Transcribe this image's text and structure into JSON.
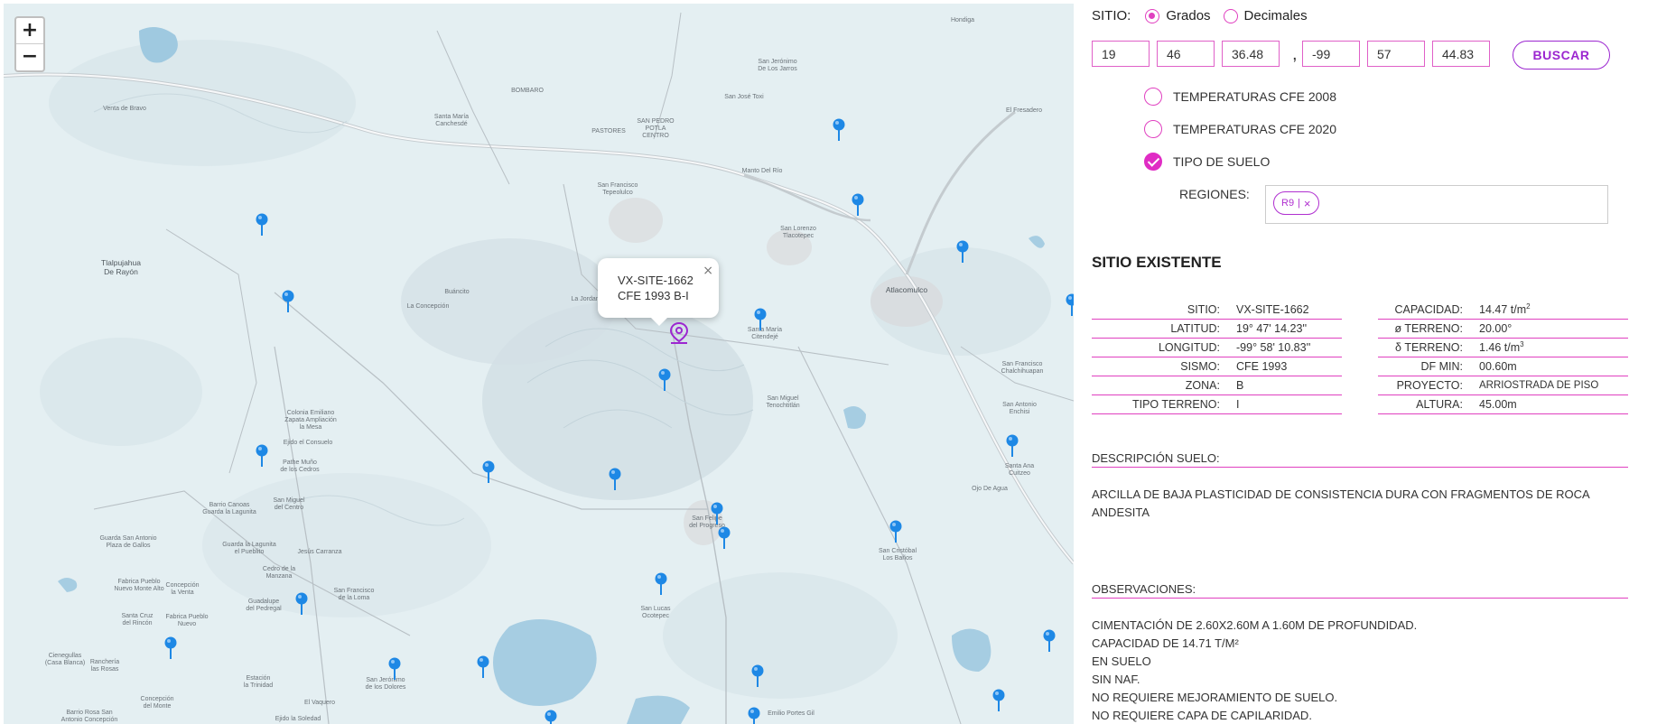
{
  "map": {
    "zoom_in": "+",
    "zoom_out": "−",
    "popup": {
      "line1": "VX-SITE-1662",
      "line2": "CFE 1993 B-I",
      "close": "×"
    },
    "labels": {
      "l1": "Tlalpujahua\nDe Rayón",
      "l2": "Atlacomulco",
      "l3": "Santa María\nCanchesdé",
      "l4": "SAN PEDRO\nPOTLA\nCENTRO",
      "l5": "PASTORES",
      "l6": "San Francisco\nTepeolulco",
      "l7": "Manto Del Río",
      "l8": "San Lorenzo\nTlacotepec",
      "l9": "San Jerónimo\nDe Los Jarros",
      "l10": "San José Toxi",
      "l11": "Hondiga",
      "l12": "El Fresadero",
      "l13": "Santa María\nCitendejé",
      "l14": "San Miguel\nTenochtitlán",
      "l15": "Colonia Emiliano\nZapata Ampliación\nla Mesa",
      "l16": "Ejido el Consuelo",
      "l17": "Pathe Muño\nde los Cedros",
      "l18": "San Miguel\ndel Centro",
      "l19": "Guarda la Lagunita\nel Pueblito",
      "l20": "Barrio Canoas\nGuarda la Lagunita",
      "l21": "Guarda San Antonio\nPlaza de Gallos",
      "l22": "San Francisco\nde la Loma",
      "l23": "Jesús Carranza",
      "l24": "Cedro de la\nManzana",
      "l25": "Guadalupe\ndel Pedregal",
      "l26": "San Lucas\nOcotepec",
      "l27": "San Cristóbal\nLos Baños",
      "l28": "San Felipe\ndel Progreso",
      "l29": "Santa Cruz\ndel Rincón",
      "l30": "San Jerónimo\nde los Dolores",
      "l31": "Estación\nla Trinidad",
      "l32": "Concepción\ndel Monte",
      "l33": "Barrio Rosa San\nAntonio Concepción",
      "l34": "Emilio Portes Gil",
      "l35": "San Antonio\nEnchisi",
      "l36": "San Francisco\nChalchihuapan",
      "l37": "Ejido la Soledad",
      "l38": "El Vaquero",
      "l39": "BOMBARO",
      "l40": "Venta de Bravo",
      "l41": "La Jordana",
      "l42": "Buáncito",
      "l43": "La Concepción",
      "l44": "Fabrica Pueblo\nNuevo Monte Alto",
      "l45": "Concepción\nla Venta",
      "l46": "Fabrica Pueblo\nNuevo",
      "l47": "Ojo De Agua",
      "l48": "Santa Ana\nCuitzeo",
      "l49": "Cienegullas\n(Casa Blanca)",
      "l50": "Ranchería\nlas Rosas"
    }
  },
  "panel": {
    "sitio_label": "SITIO:",
    "opt_grados": "Grados",
    "opt_decimales": "Decimales",
    "coords": [
      "19",
      "46",
      "36.48",
      "-99",
      "57",
      "44.83"
    ],
    "comma": ",",
    "buscar": "BUSCAR",
    "layers": [
      "TEMPERATURAS CFE 2008",
      "TEMPERATURAS CFE 2020",
      "TIPO DE SUELO"
    ],
    "regiones_label": "REGIONES:",
    "region_tag": "R9",
    "region_sep": "|",
    "region_remove": "×",
    "existente_title": "SITIO EXISTENTE",
    "left_table": [
      {
        "k": "SITIO:",
        "v": "VX-SITE-1662"
      },
      {
        "k": "LATITUD:",
        "v": "19° 47' 14.23''"
      },
      {
        "k": "LONGITUD:",
        "v": "-99° 58' 10.83''"
      },
      {
        "k": "SISMO:",
        "v": "CFE 1993"
      },
      {
        "k": "ZONA:",
        "v": "B"
      },
      {
        "k": "TIPO TERRENO:",
        "v": "I"
      }
    ],
    "right_table": [
      {
        "k": "CAPACIDAD:",
        "v": "14.47 t/m",
        "sup": "2"
      },
      {
        "k": "ø TERRENO:",
        "v": "20.00°",
        "sup": ""
      },
      {
        "k": "δ TERRENO:",
        "v": "1.46 t/m",
        "sup": "3"
      },
      {
        "k": "DF MIN:",
        "v": "00.60m",
        "sup": ""
      },
      {
        "k": "PROYECTO:",
        "v": "ARRIOSTRADA DE PISO",
        "sup": ""
      },
      {
        "k": "ALTURA:",
        "v": "45.00m",
        "sup": ""
      }
    ],
    "desc_title": "DESCRIPCIÓN SUELO:",
    "desc_text": "ARCILLA DE BAJA PLASTICIDAD DE CONSISTENCIA DURA CON FRAGMENTOS DE ROCA ANDESITA",
    "obs_title": "OBSERVACIONES:",
    "obs_lines": [
      "CIMENTACIÓN DE 2.60X2.60M A 1.60M DE PROFUNDIDAD.",
      "CAPACIDAD DE 14.71 T/M²",
      "EN SUELO",
      "SIN NAF.",
      "NO REQUIERE MEJORAMIENTO DE SUELO.",
      "NO REQUIERE CAPA DE CAPILARIDAD."
    ],
    "colors": {
      "accent": "#e040c0",
      "button": "#9c27d0",
      "pin": "#1e88e5"
    }
  }
}
